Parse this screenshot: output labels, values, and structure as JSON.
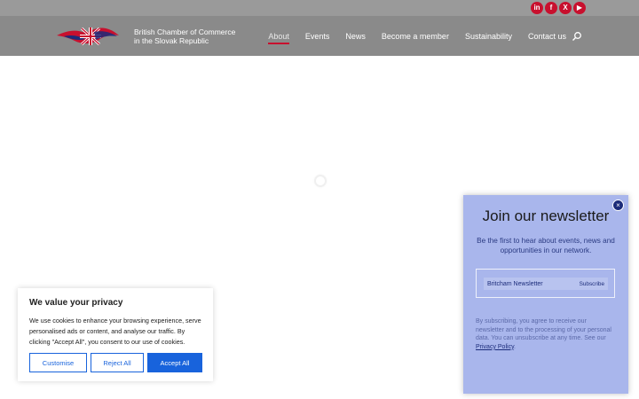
{
  "social": [
    {
      "label": "in",
      "icon": "linkedin-icon"
    },
    {
      "label": "f",
      "icon": "facebook-icon"
    },
    {
      "label": "X",
      "icon": "x-icon"
    },
    {
      "label": "▶",
      "icon": "youtube-icon"
    }
  ],
  "brand": {
    "line1": "British Chamber of Commerce",
    "line2": "in the Slovak Republic"
  },
  "nav": {
    "about": "About",
    "events": "Events",
    "news": "News",
    "become_member": "Become a member",
    "sustainability": "Sustainability",
    "contact": "Contact us"
  },
  "cookie": {
    "title": "We value your privacy",
    "text": "We use cookies to enhance your browsing experience, serve personalised ads or content, and analyse our traffic. By clicking \"Accept All\", you consent to our use of cookies.",
    "customise": "Customise",
    "reject": "Reject All",
    "accept": "Accept All"
  },
  "newsletter": {
    "close": "×",
    "title": "Join our newsletter",
    "subtitle": "Be the first to hear about events, news and opportunities in our network.",
    "field_label": "Britcham Newsletter",
    "subscribe": "Subscribe",
    "legal": "By subscribing, you agree to receive our newsletter and to the processing of your personal data. You can unsubscribe at any time. See our ",
    "privacy_link": "Privacy Policy",
    "legal_end": "."
  },
  "colors": {
    "accent_red": "#c8102e",
    "primary_blue": "#1863dc",
    "header_gray": "#8a8a8a",
    "newsletter_bg": "#a9b6ec"
  }
}
